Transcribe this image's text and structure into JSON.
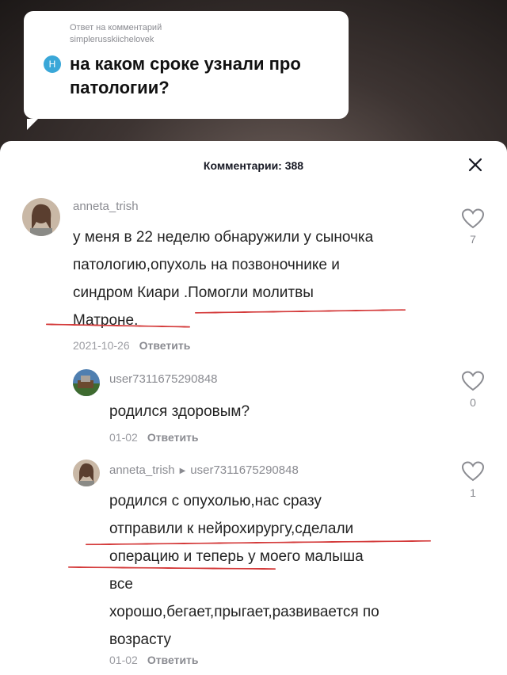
{
  "reply_card": {
    "header_line1": "Ответ на комментарий",
    "header_line2": "simplerusskiichelovek",
    "avatar_letter": "H",
    "question": "на каком сроке узнали про патологии?"
  },
  "sheet": {
    "title": "Комментарии: 388"
  },
  "comments": [
    {
      "username": "anneta_trish",
      "text_lines": [
        "у меня в 22 неделю обнаружили у сыночка",
        "патологию,опухоль на позвоночнике и",
        "синдром Киари .Помогли молитвы",
        "Матроне."
      ],
      "date": "2021-10-26",
      "reply_label": "Ответить",
      "likes": "7"
    },
    {
      "username": "user7311675290848",
      "text_lines": [
        "родился здоровым?"
      ],
      "date": "01-02",
      "reply_label": "Ответить",
      "likes": "0"
    },
    {
      "username": "anneta_trish",
      "reply_to": "user7311675290848",
      "text_lines": [
        "родился с опухолью,нас сразу",
        "отправили к нейрохирургу,сделали",
        "операцию и теперь у моего малыша",
        "все",
        "хорошо,бегает,прыгает,развивается по",
        "возрасту"
      ],
      "date": "01-02",
      "reply_label": "Ответить",
      "likes": "1"
    }
  ],
  "colors": {
    "underline": "#d43b3b",
    "reply_avatar": "#3aa7d8"
  }
}
